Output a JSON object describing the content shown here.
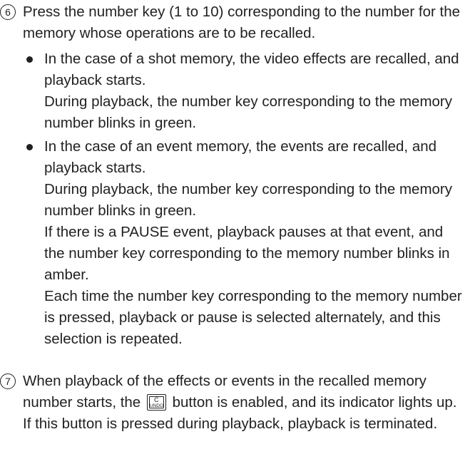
{
  "steps": [
    {
      "number": "6",
      "text": "Press the number key (1 to 10) corresponding to the number for the memory whose operations are to be recalled.",
      "bullets": [
        {
          "lines": [
            "In the case of a shot memory, the video effects are recalled, and playback starts.",
            "During playback, the number key corresponding to the memory number blinks in green."
          ]
        },
        {
          "lines": [
            "In the case of an event memory, the events are recalled, and playback starts.",
            "During playback, the number key corresponding to the memory number blinks in green.",
            "If there is a PAUSE event, playback pauses at that event, and the number key corresponding to the memory number blinks in amber.",
            "Each time the number key corresponding to the memory number is pressed, playback or pause is selected alternately, and this selection is repeated."
          ]
        }
      ]
    },
    {
      "number": "7",
      "text_before": "When playback of the effects or events in the recalled memory number starts, the",
      "button": {
        "top": "C",
        "bottom": "UNDO",
        "icon": "undo-button-icon"
      },
      "text_after": "button is enabled, and its indicator lights up. If this button is pressed during playback, playback is terminated."
    }
  ]
}
